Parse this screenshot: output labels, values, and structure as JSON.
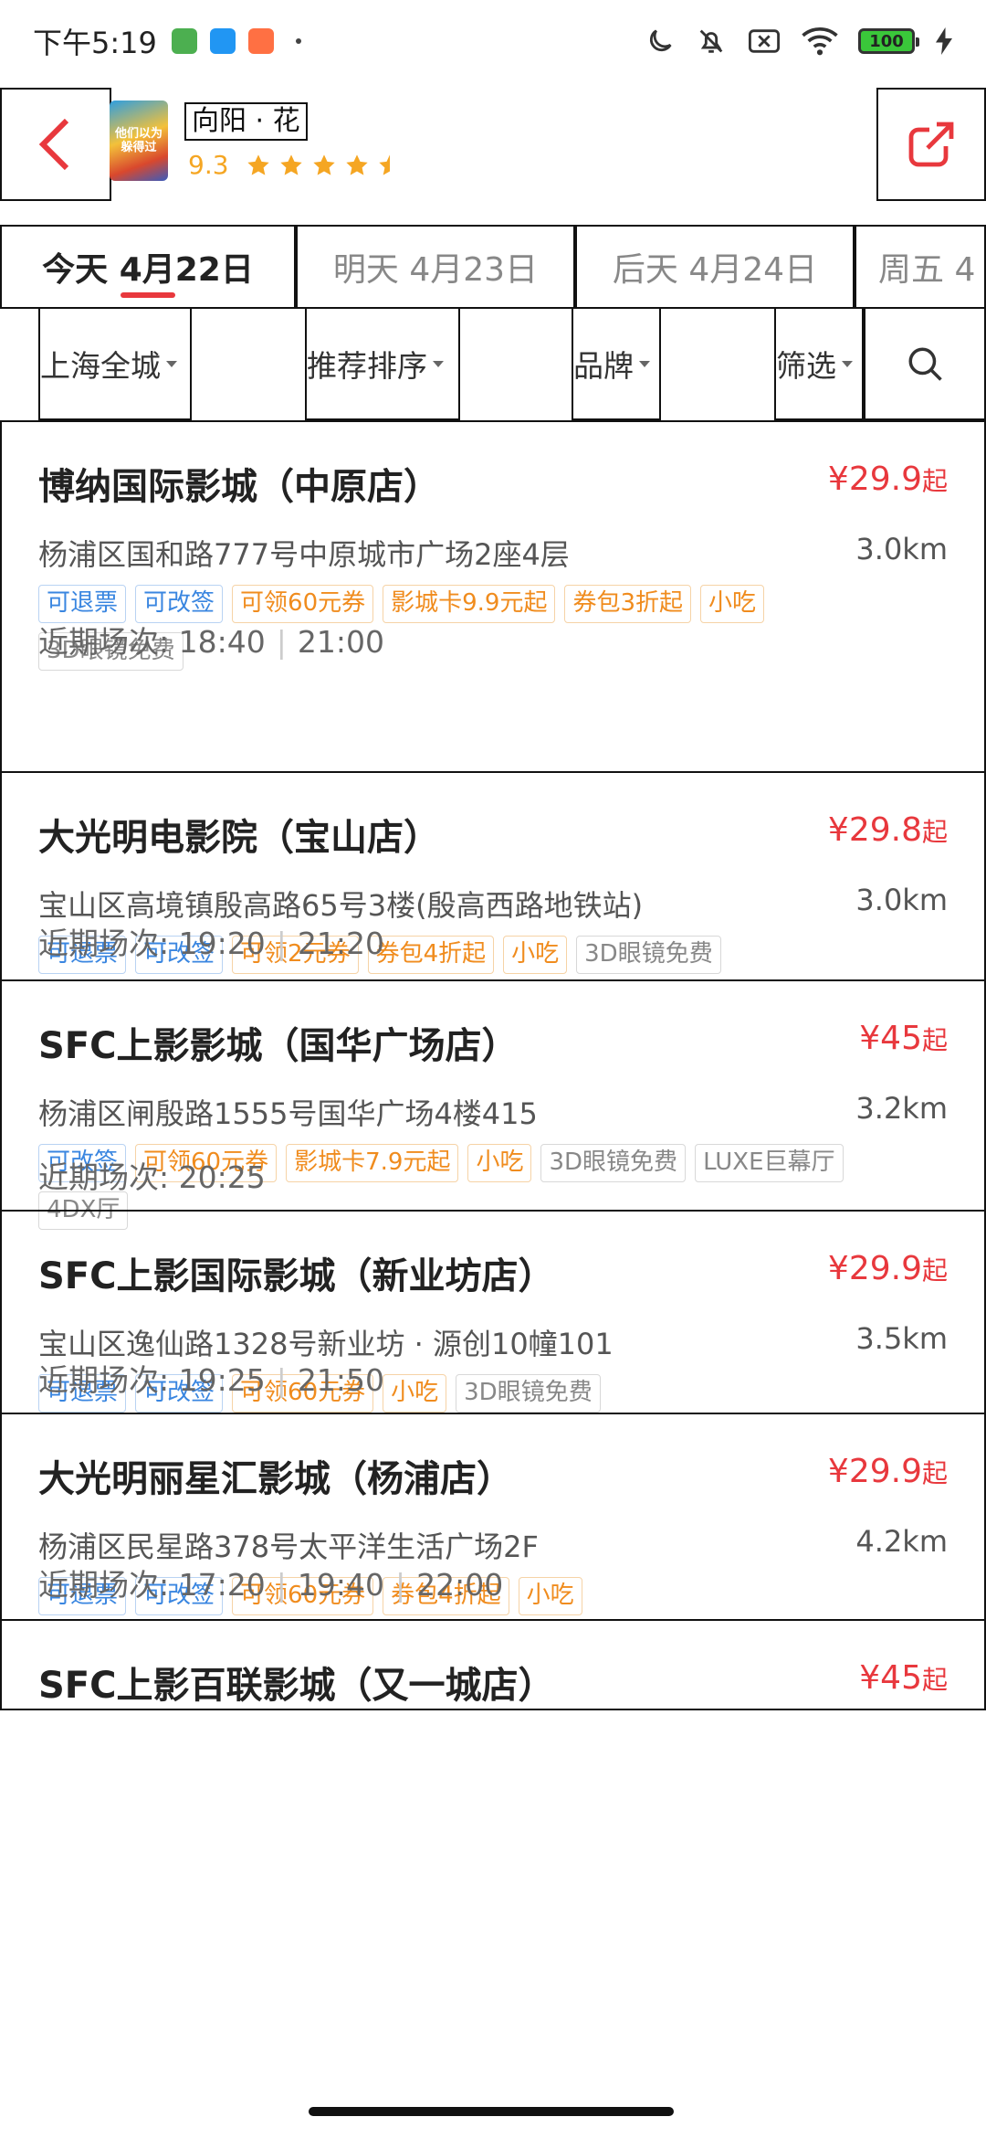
{
  "status": {
    "time": "下午5:19",
    "battery": "100"
  },
  "header": {
    "movie_title": "向阳 · 花",
    "poster_text": "他们以为躲得过",
    "rating": "9.3",
    "stars": 4.5
  },
  "date_tabs": [
    {
      "label": "今天 4月22日",
      "active": true
    },
    {
      "label": "明天 4月23日",
      "active": false
    },
    {
      "label": "后天 4月24日",
      "active": false
    },
    {
      "label": "周五 4",
      "active": false
    }
  ],
  "filters": {
    "city": "上海全城",
    "sort": "推荐排序",
    "brand": "品牌",
    "screen": "筛选"
  },
  "cinemas": [
    {
      "name": "博纳国际影城（中原店）",
      "price": "¥29.9",
      "price_suffix": "起",
      "address": "杨浦区国和路777号中原城市广场2座4层",
      "distance": "3.0km",
      "tags": [
        {
          "text": "可退票",
          "color": "blue"
        },
        {
          "text": "可改签",
          "color": "blue"
        },
        {
          "text": "可领60元券",
          "color": "orange"
        },
        {
          "text": "影城卡9.9元起",
          "color": "orange"
        },
        {
          "text": "券包3折起",
          "color": "orange"
        },
        {
          "text": "小吃",
          "color": "orange"
        },
        {
          "text": "3D眼镜免费",
          "color": "gray"
        }
      ],
      "sessions_label": "近期场次:",
      "sessions": [
        "18:40",
        "21:00"
      ]
    },
    {
      "name": "大光明电影院（宝山店）",
      "price": "¥29.8",
      "price_suffix": "起",
      "address": "宝山区高境镇殷高路65号3楼(殷高西路地铁站)",
      "distance": "3.0km",
      "tags": [
        {
          "text": "可退票",
          "color": "blue"
        },
        {
          "text": "可改签",
          "color": "blue"
        },
        {
          "text": "可领2元券",
          "color": "orange"
        },
        {
          "text": "券包4折起",
          "color": "orange"
        },
        {
          "text": "小吃",
          "color": "orange"
        },
        {
          "text": "3D眼镜免费",
          "color": "gray"
        }
      ],
      "sessions_label": "近期场次:",
      "sessions": [
        "19:20",
        "21:20"
      ]
    },
    {
      "name": "SFC上影影城（国华广场店）",
      "price": "¥45",
      "price_suffix": "起",
      "address": "杨浦区闸殷路1555号国华广场4楼415",
      "distance": "3.2km",
      "tags": [
        {
          "text": "可改签",
          "color": "blue"
        },
        {
          "text": "可领60元券",
          "color": "orange"
        },
        {
          "text": "影城卡7.9元起",
          "color": "orange"
        },
        {
          "text": "小吃",
          "color": "orange"
        },
        {
          "text": "3D眼镜免费",
          "color": "gray"
        },
        {
          "text": "LUXE巨幕厅",
          "color": "gray"
        },
        {
          "text": "4DX厅",
          "color": "gray"
        }
      ],
      "sessions_label": "近期场次:",
      "sessions": [
        "20:25"
      ]
    },
    {
      "name": "SFC上影国际影城（新业坊店）",
      "price": "¥29.9",
      "price_suffix": "起",
      "address": "宝山区逸仙路1328号新业坊 · 源创10幢101",
      "distance": "3.5km",
      "tags": [
        {
          "text": "可退票",
          "color": "blue"
        },
        {
          "text": "可改签",
          "color": "blue"
        },
        {
          "text": "可领60元券",
          "color": "orange"
        },
        {
          "text": "小吃",
          "color": "orange"
        },
        {
          "text": "3D眼镜免费",
          "color": "gray"
        }
      ],
      "sessions_label": "近期场次:",
      "sessions": [
        "19:25",
        "21:50"
      ]
    },
    {
      "name": "大光明丽星汇影城（杨浦店）",
      "price": "¥29.9",
      "price_suffix": "起",
      "address": "杨浦区民星路378号太平洋生活广场2F",
      "distance": "4.2km",
      "tags": [
        {
          "text": "可退票",
          "color": "blue"
        },
        {
          "text": "可改签",
          "color": "blue"
        },
        {
          "text": "可领60元券",
          "color": "orange"
        },
        {
          "text": "券包4折起",
          "color": "orange"
        },
        {
          "text": "小吃",
          "color": "orange"
        }
      ],
      "sessions_label": "近期场次:",
      "sessions": [
        "17:20",
        "19:40",
        "22:00"
      ]
    },
    {
      "name": "SFC上影百联影城（又一城店）",
      "price": "¥45",
      "price_suffix": "起",
      "address": "",
      "distance": "",
      "tags": [],
      "sessions_label": "",
      "sessions": []
    }
  ],
  "colors": {
    "accent_red": "#e8383d",
    "star_yellow": "#f5a623",
    "tag_blue": "#3a86e0",
    "tag_orange": "#f08c1e",
    "tag_gray": "#888888"
  }
}
